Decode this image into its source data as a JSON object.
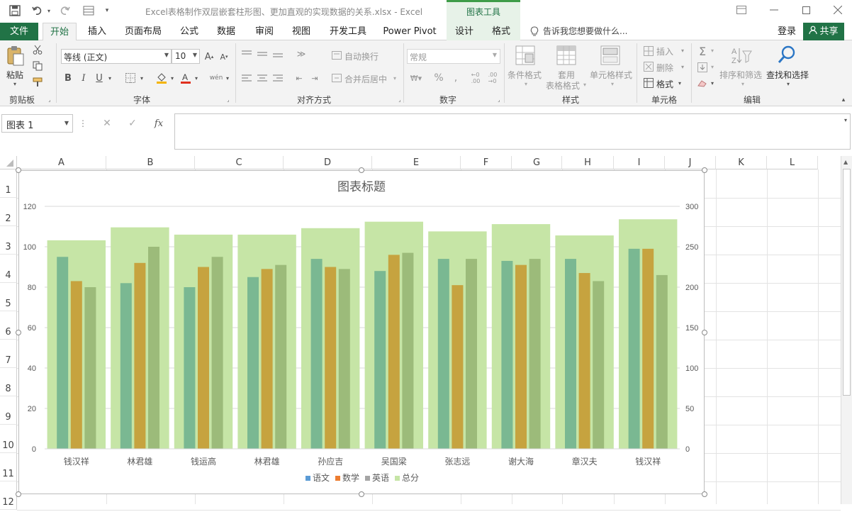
{
  "title_bar": {
    "doc_title": "Excel表格制作双层嵌套柱形图、更加直观的实现数据的关系.xlsx - Excel",
    "context_tools": "图表工具"
  },
  "tabs": {
    "file": "文件",
    "items": [
      "开始",
      "插入",
      "页面布局",
      "公式",
      "数据",
      "审阅",
      "视图",
      "开发工具",
      "Power Pivot",
      "设计",
      "格式"
    ],
    "tell_me": "告诉我您想要做什么...",
    "login": "登录",
    "share": "共享"
  },
  "ribbon": {
    "clipboard": {
      "paste": "粘贴",
      "label": "剪贴板"
    },
    "font": {
      "name": "等线 (正文)",
      "size": "10",
      "bold": "B",
      "italic": "I",
      "underline": "U",
      "label": "字体"
    },
    "alignment": {
      "wrap": "自动换行",
      "merge": "合并后居中",
      "label": "对齐方式"
    },
    "number": {
      "format": "常规",
      "label": "数字"
    },
    "styles": {
      "conditional": "条件格式",
      "table_format_1": "套用",
      "table_format_2": "表格格式",
      "cell_styles": "单元格样式",
      "label": "样式"
    },
    "cells": {
      "insert": "插入",
      "delete": "删除",
      "format": "格式",
      "label": "单元格"
    },
    "editing": {
      "sort": "排序和筛选",
      "find": "查找和选择",
      "label": "编辑"
    }
  },
  "formula_bar": {
    "name_box": "图表 1",
    "fx": "fx",
    "value": ""
  },
  "sheet": {
    "columns": [
      "A",
      "B",
      "C",
      "D",
      "E",
      "F",
      "G",
      "H",
      "I",
      "J",
      "K",
      "L"
    ],
    "rows": [
      "1",
      "2",
      "3",
      "4",
      "5",
      "6",
      "7",
      "8",
      "9",
      "10",
      "11",
      "12"
    ]
  },
  "chart_data": {
    "type": "bar",
    "title": "图表标题",
    "categories": [
      "钱汉祥",
      "林君雄",
      "钱运高",
      "林君雄",
      "孙应吉",
      "吴国梁",
      "张志远",
      "谢大海",
      "章汉夫",
      "钱汉祥"
    ],
    "series": [
      {
        "name": "语文",
        "axis": "primary",
        "values": [
          95,
          82,
          80,
          85,
          94,
          88,
          94,
          93,
          94,
          99
        ]
      },
      {
        "name": "数学",
        "axis": "primary",
        "values": [
          83,
          92,
          90,
          89,
          90,
          96,
          81,
          91,
          87,
          99
        ]
      },
      {
        "name": "英语",
        "axis": "primary",
        "values": [
          80,
          100,
          95,
          91,
          89,
          97,
          94,
          94,
          83,
          86
        ]
      },
      {
        "name": "总分",
        "axis": "secondary",
        "values": [
          258,
          274,
          265,
          265,
          273,
          281,
          269,
          278,
          264,
          284
        ]
      }
    ],
    "y_left": {
      "min": 0,
      "max": 120,
      "ticks": [
        "0",
        "20",
        "40",
        "60",
        "80",
        "100",
        "120"
      ]
    },
    "y_right": {
      "min": 0,
      "max": 300,
      "ticks": [
        "0",
        "50",
        "100",
        "150",
        "200",
        "250",
        "300"
      ]
    },
    "colors": {
      "语文": "#7ab892",
      "数学": "#c6a33f",
      "英语": "#9cbb7a",
      "总分": "#c6e5a6"
    },
    "legend_colors": {
      "语文": "#5b9bd5",
      "数学": "#ed7d31",
      "英语": "#a5a5a5",
      "总分": "#c6e5a6"
    },
    "legend": "bottom",
    "grid": true
  }
}
